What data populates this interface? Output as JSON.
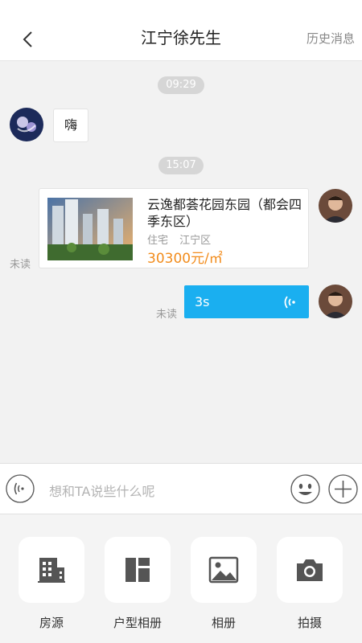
{
  "header": {
    "title": "江宁徐先生",
    "history_label": "历史消息"
  },
  "messages": {
    "time1": "09:29",
    "greeting": "嗨",
    "time2": "15:07",
    "card": {
      "name": "云逸都荟花园东园（都会四季东区）",
      "type": "住宅",
      "district": "江宁区",
      "price": "30300元/㎡"
    },
    "unread_label": "未读",
    "voice_duration": "3s"
  },
  "input": {
    "placeholder": "想和TA说些什么呢"
  },
  "tools": [
    {
      "label": "房源",
      "icon": "building-icon"
    },
    {
      "label": "户型相册",
      "icon": "floorplan-icon"
    },
    {
      "label": "相册",
      "icon": "image-icon"
    },
    {
      "label": "拍摄",
      "icon": "camera-icon"
    }
  ],
  "colors": {
    "accent": "#1aaff0",
    "price": "#f28c1c"
  }
}
